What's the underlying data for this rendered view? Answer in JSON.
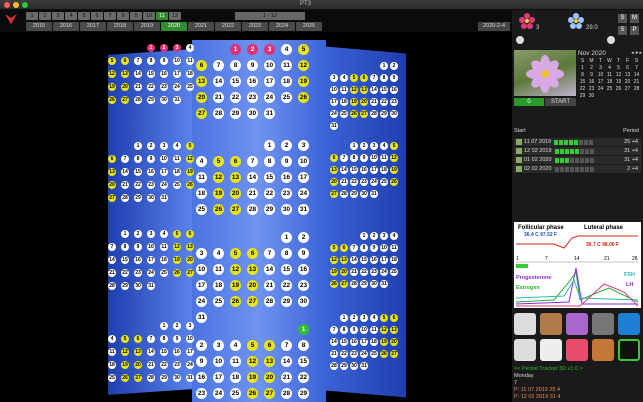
{
  "window": {
    "title": "PT3"
  },
  "months": [
    "1",
    "2",
    "3",
    "4",
    "5",
    "6",
    "7",
    "8",
    "9",
    "10",
    "11",
    "12"
  ],
  "selected_month": "11",
  "years": [
    "2015",
    "2016",
    "2017",
    "2018",
    "2019",
    "2020",
    "2021",
    "2022",
    "2023",
    "2024",
    "2025"
  ],
  "selected_year": "2020",
  "month_range": "1 - 12",
  "current_date": "2020-2-4",
  "flower_counts": {
    "left": "3",
    "right": "29.0"
  },
  "buttons": {
    "s": "S",
    "m": "M",
    "s2": "S",
    "p": "P"
  },
  "photo_controls": {
    "counter": "0",
    "start": "START"
  },
  "mini_calendar": {
    "title": "Nov 2020",
    "weekdays": [
      "S",
      "M",
      "T",
      "W",
      "T",
      "F",
      "S"
    ],
    "days": [
      "1",
      "2",
      "3",
      "4",
      "5",
      "6",
      "7",
      "8",
      "9",
      "10",
      "11",
      "12",
      "13",
      "14",
      "15",
      "16",
      "17",
      "18",
      "19",
      "20",
      "21",
      "22",
      "23",
      "24",
      "25",
      "26",
      "27",
      "28",
      "29",
      "30"
    ]
  },
  "periods": {
    "start_label": "Start",
    "period_label": "Period",
    "rows": [
      {
        "date": "11 07 2019",
        "value": "25 +4",
        "filled": 5
      },
      {
        "date": "12 02 2019",
        "value": "31 +4",
        "filled": 5
      },
      {
        "date": "01 02 2020",
        "value": "31 +4",
        "filled": 3
      },
      {
        "date": "02 02 2020",
        "value": "2 +4",
        "filled": 0
      }
    ]
  },
  "cycle_chart": {
    "follicular": "Follicular phase",
    "luteal": "Luteral phase",
    "temp1": "36.4 C  97.52 F",
    "temp2": "36.7 C  98.06 F",
    "ticks": [
      "1",
      "7",
      "14",
      "21",
      "28"
    ],
    "progesterone": "Progesterone",
    "estrogen": "Estrogen",
    "fsh": "FSH",
    "lh": "LH"
  },
  "footer": {
    "app": "<< Period Tracker 3D v1.0 >",
    "weekday": "Monday",
    "day_num": "7",
    "line1": "P: 11 07 2019 25  4",
    "line2": "P: 12 02 2019 31  4"
  },
  "colors": {
    "accent": "#2f8f2f",
    "highlight": "#e8e41a",
    "panel": "#3a63d8"
  }
}
